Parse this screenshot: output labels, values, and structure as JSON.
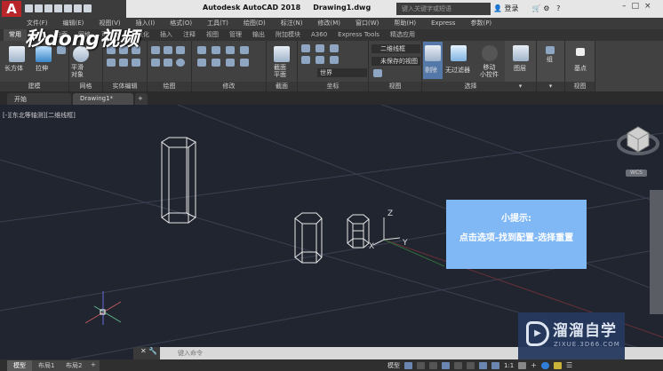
{
  "app": {
    "title": "Autodesk AutoCAD 2018",
    "file": "Drawing1.dwg",
    "search_placeholder": "键入关键字或短语",
    "login": "登录",
    "logo": "A"
  },
  "menu": [
    "文件(F)",
    "编辑(E)",
    "视图(V)",
    "插入(I)",
    "格式(O)",
    "工具(T)",
    "绘图(D)",
    "标注(N)",
    "修改(M)",
    "窗口(W)",
    "帮助(H)",
    "Express",
    "参数(P)"
  ],
  "ribbon_tabs": [
    "常用",
    "实体",
    "曲面",
    "网格",
    "可视化",
    "参数化",
    "插入",
    "注释",
    "视图",
    "管理",
    "输出",
    "附加模块",
    "A360",
    "Express Tools",
    "精选应用"
  ],
  "brand_overlay": "秒dong视频",
  "ribbon": {
    "buttons": {
      "box": "长方体",
      "extrude": "拉伸",
      "smooth": "平滑\n对象",
      "section": "截面\n平面",
      "culling": "剔除",
      "nofilter": "无过滤器",
      "gizmo": "移动\n小控件",
      "layers": "图层",
      "group": "组",
      "base": "基点"
    },
    "visual_style": "二维线框",
    "named_view": "未保存的视图",
    "world": "世界",
    "panels": [
      "建模",
      "网格",
      "实体编辑",
      "绘图",
      "修改",
      "截面",
      "坐标",
      "视图",
      "选择",
      "视图"
    ]
  },
  "file_tabs": [
    "开始",
    "Drawing1*",
    "+"
  ],
  "viewport": {
    "label": "[-][东北等轴测][二维线框]",
    "wcs": "WCS",
    "axis_x": "X",
    "axis_y": "Y",
    "axis_z": "Z"
  },
  "hint": {
    "title": "小提示:",
    "body": "点击选项-找到配置-选择重置"
  },
  "command": {
    "placeholder": "键入命令"
  },
  "layout_tabs": [
    "模型",
    "布局1",
    "布局2",
    "+"
  ],
  "status": {
    "model": "模型",
    "scale": "1:1"
  },
  "watermark": {
    "name": "溜溜自学",
    "url": "ZIXUE.3D66.COM"
  }
}
